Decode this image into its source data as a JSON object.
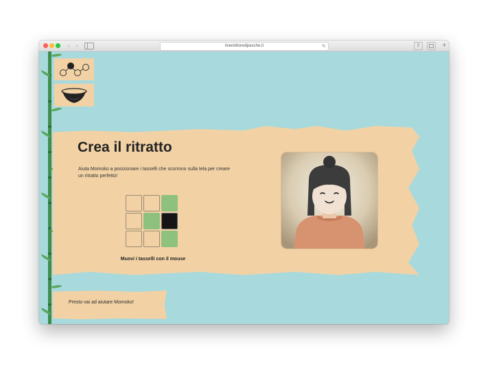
{
  "browser": {
    "url": "ilvenditoredipesche.it",
    "nav_back": "‹",
    "nav_forward": "›",
    "reload": "↻",
    "share": "⇪",
    "new_tab": "+"
  },
  "main": {
    "title": "Crea il ritratto",
    "description": "Aiuta Momoko a posizionare i tasselli che scorrono sulla tela per creare un ritratto perfetto!",
    "instruction": "Muovi i tasselli con il mouse",
    "puzzle_grid": [
      [
        "empty",
        "empty",
        "green"
      ],
      [
        "empty",
        "green",
        "black"
      ],
      [
        "empty",
        "empty",
        "green"
      ]
    ]
  },
  "footer": {
    "toast": "Presto vai ad aiutare Momoko!"
  },
  "icons": {
    "graph": "nodes-graph-icon",
    "bowl": "bowl-icon"
  },
  "colors": {
    "background": "#a8d9dc",
    "paper": "#f2d2a5",
    "tile_green": "#8fc17e",
    "tile_black": "#151515",
    "bamboo": "#3f8c4e"
  }
}
